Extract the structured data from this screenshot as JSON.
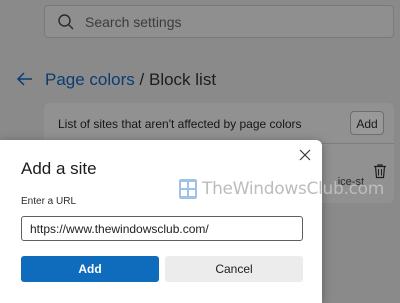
{
  "settings": {
    "search": {
      "placeholder": "Search settings"
    },
    "breadcrumb": {
      "parent": "Page colors",
      "separator": "/",
      "current": "Block list"
    },
    "card": {
      "title": "List of sites that aren't affected by page colors",
      "add_label": "Add",
      "site_fragment": "ice-st"
    }
  },
  "dialog": {
    "title": "Add a site",
    "url_label": "Enter a URL",
    "url_value": "https://www.thewindowsclub.com/",
    "add_label": "Add",
    "cancel_label": "Cancel"
  },
  "watermark": {
    "text": "TheWindowsClub.com"
  },
  "colors": {
    "accent": "#0f6cbd",
    "overlay": "#8a8a8a"
  },
  "icons": {
    "search": "search-icon",
    "back": "back-arrow-icon",
    "trash": "trash-icon",
    "close": "close-icon"
  }
}
